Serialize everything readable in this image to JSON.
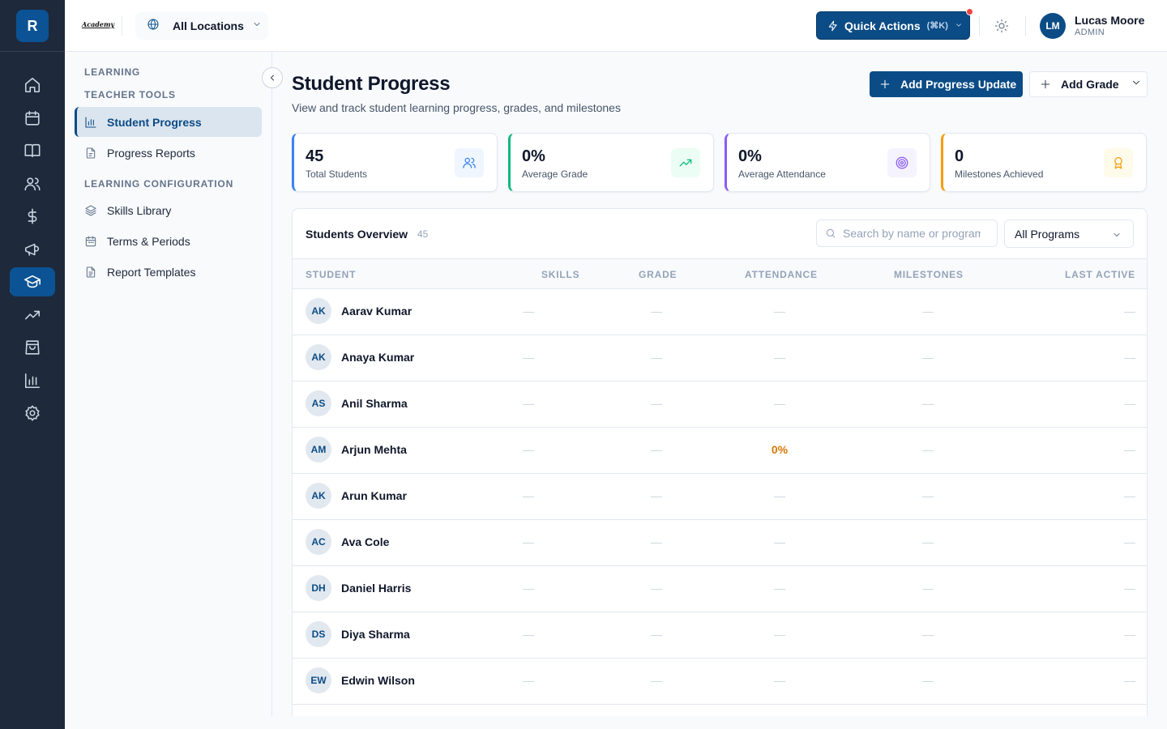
{
  "app": {
    "logo_letter": "R",
    "brand_text": "Academy",
    "location": "All Locations",
    "quick_actions_label": "Quick Actions",
    "quick_actions_shortcut": "(⌘K)",
    "user_initials": "LM",
    "user_name": "Lucas Moore",
    "user_role": "ADMIN"
  },
  "rail": {
    "items": [
      "home-icon",
      "calendar-icon",
      "book-icon",
      "users-icon",
      "dollar-icon",
      "megaphone-icon",
      "graduation-cap-icon",
      "trending-up-icon",
      "shopping-bag-icon",
      "bar-chart-icon",
      "settings-icon"
    ],
    "active": "graduation-cap-icon"
  },
  "subnav": {
    "section_learning": "LEARNING",
    "section_teacher_tools": "TEACHER TOOLS",
    "section_config": "LEARNING CONFIGURATION",
    "items": [
      {
        "label": "Student Progress",
        "icon": "bar-chart-icon",
        "active": true
      },
      {
        "label": "Progress Reports",
        "icon": "file-icon"
      },
      {
        "label": "Skills Library",
        "icon": "layers-icon"
      },
      {
        "label": "Terms & Periods",
        "icon": "calendar-icon"
      },
      {
        "label": "Report Templates",
        "icon": "file-text-icon"
      }
    ]
  },
  "page": {
    "title": "Student Progress",
    "subtitle": "View and track student learning progress, grades, and milestones",
    "add_progress_label": "Add Progress Update",
    "add_grade_label": "Add Grade"
  },
  "stats": [
    {
      "value": "45",
      "label": "Total Students",
      "accent": "#3b82f6",
      "icon": "users-icon"
    },
    {
      "value": "0%",
      "label": "Average Grade",
      "accent": "#10b981",
      "icon": "trending-up-icon"
    },
    {
      "value": "0%",
      "label": "Average Attendance",
      "accent": "#8b5cf6",
      "icon": "target-icon"
    },
    {
      "value": "0",
      "label": "Milestones Achieved",
      "accent": "#f59e0b",
      "icon": "award-icon"
    }
  ],
  "overview": {
    "title": "Students Overview",
    "count": "45",
    "search_placeholder": "Search by name or program",
    "program_filter": "All Programs",
    "columns": [
      "STUDENT",
      "SKILLS",
      "GRADE",
      "ATTENDANCE",
      "MILESTONES",
      "LAST ACTIVE"
    ],
    "rows": [
      {
        "initials": "AK",
        "name": "Aarav Kumar",
        "skills": "—",
        "grade": "—",
        "attendance": "—",
        "milestones": "—",
        "last_active": "—"
      },
      {
        "initials": "AK",
        "name": "Anaya Kumar",
        "skills": "—",
        "grade": "—",
        "attendance": "—",
        "milestones": "—",
        "last_active": "—"
      },
      {
        "initials": "AS",
        "name": "Anil Sharma",
        "skills": "—",
        "grade": "—",
        "attendance": "—",
        "milestones": "—",
        "last_active": "—"
      },
      {
        "initials": "AM",
        "name": "Arjun Mehta",
        "skills": "—",
        "grade": "—",
        "attendance": "0%",
        "milestones": "—",
        "last_active": "—"
      },
      {
        "initials": "AK",
        "name": "Arun Kumar",
        "skills": "—",
        "grade": "—",
        "attendance": "—",
        "milestones": "—",
        "last_active": "—"
      },
      {
        "initials": "AC",
        "name": "Ava Cole",
        "skills": "—",
        "grade": "—",
        "attendance": "—",
        "milestones": "—",
        "last_active": "—"
      },
      {
        "initials": "DH",
        "name": "Daniel Harris",
        "skills": "—",
        "grade": "—",
        "attendance": "—",
        "milestones": "—",
        "last_active": "—"
      },
      {
        "initials": "DS",
        "name": "Diya Sharma",
        "skills": "—",
        "grade": "—",
        "attendance": "—",
        "milestones": "—",
        "last_active": "—"
      },
      {
        "initials": "EW",
        "name": "Edwin Wilson",
        "skills": "—",
        "grade": "—",
        "attendance": "—",
        "milestones": "—",
        "last_active": "—"
      }
    ]
  }
}
